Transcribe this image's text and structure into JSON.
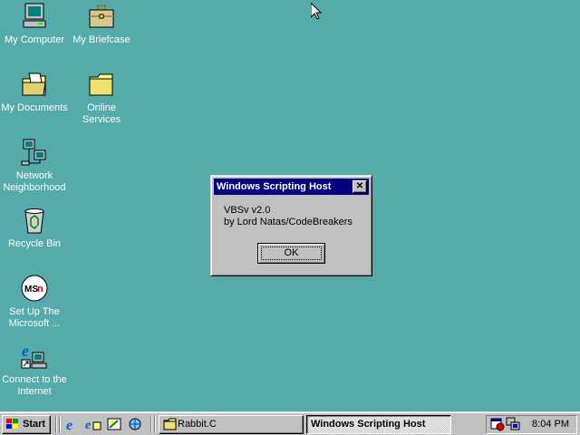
{
  "desktop": {
    "background_color": "#55aaaa",
    "icons": [
      {
        "label": "My Computer",
        "icon": "computer-icon"
      },
      {
        "label": "My Briefcase",
        "icon": "briefcase-icon"
      },
      {
        "label": "My Documents",
        "icon": "documents-folder-icon"
      },
      {
        "label": "Online\nServices",
        "icon": "folder-icon"
      },
      {
        "label": "Network\nNeighborhood",
        "icon": "network-icon"
      },
      {
        "label": "Recycle Bin",
        "icon": "recycle-bin-icon"
      },
      {
        "label": "Set Up The\nMicrosoft ...",
        "icon": "msn-icon"
      },
      {
        "label": "Connect to the\nInternet",
        "icon": "internet-connect-icon"
      }
    ]
  },
  "dialog": {
    "title": "Windows Scripting Host",
    "close_label": "✕",
    "message_line1": "VBSv v2.0",
    "message_line2": "by Lord Natas/CodeBreakers",
    "ok_label": "OK"
  },
  "taskbar": {
    "start_label": "Start",
    "quick_launch": [
      "internet-explorer-icon",
      "outlook-express-icon",
      "show-desktop-icon",
      "channels-icon"
    ],
    "tasks": [
      {
        "label": "Rabbit.C",
        "icon": "folder-icon",
        "active": false
      },
      {
        "label": "Windows Scripting Host",
        "active": true
      }
    ],
    "tray_icons": [
      "scheduler-icon",
      "network-tray-icon"
    ],
    "clock": "8:04 PM"
  }
}
